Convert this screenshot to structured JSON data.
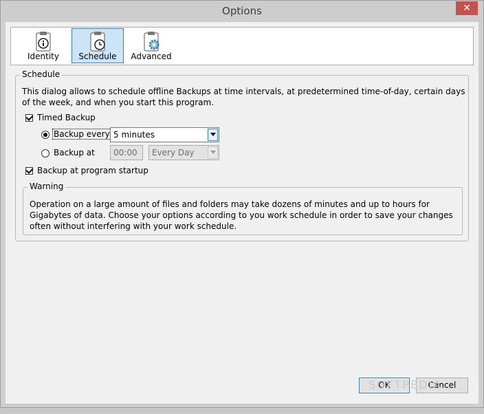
{
  "window": {
    "title": "Options",
    "close_glyph": "✕"
  },
  "toolbar": {
    "items": [
      {
        "label": "Identity",
        "icon": "clipboard-info-icon",
        "active": false
      },
      {
        "label": "Schedule",
        "icon": "clipboard-clock-icon",
        "active": true
      },
      {
        "label": "Advanced",
        "icon": "clipboard-gear-icon",
        "active": false
      }
    ]
  },
  "schedule": {
    "group_title": "Schedule",
    "description": "This dialog allows to schedule offline Backups at time intervals, at predetermined time-of-day, certain days of the week, and when you start this program.",
    "timed_backup": {
      "label": "Timed Backup",
      "checked": true
    },
    "backup_every": {
      "label": "Backup every",
      "selected": true,
      "value": "5 minutes"
    },
    "backup_at": {
      "label": "Backup at",
      "selected": false,
      "time": "00:00",
      "day": "Every Day"
    },
    "startup": {
      "label": "Backup at program startup",
      "checked": true
    }
  },
  "warning": {
    "title": "Warning",
    "text": "Operation on a large amount of files and folders may take dozens of minutes and up to hours for Gigabytes of data. Choose your options according to you work schedule in order to save your changes often without interfering with your work schedule."
  },
  "buttons": {
    "ok": "OK",
    "cancel": "Cancel"
  },
  "watermark": "SOFTPEDIA",
  "colors": {
    "accent": "#3c7fb1",
    "selected_tab_bg": "#cce4f7",
    "close": "#c75050"
  }
}
